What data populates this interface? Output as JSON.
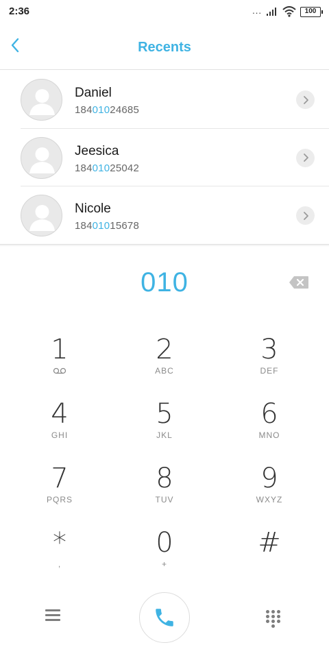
{
  "status_bar": {
    "time": "2:36",
    "signal_dots": "...",
    "battery": "100"
  },
  "header": {
    "title": "Recents",
    "back_icon": "chevron-left-icon"
  },
  "contacts": [
    {
      "name": "Daniel",
      "number_pre": "184",
      "number_match": "010",
      "number_post": "24685"
    },
    {
      "name": "Jeesica",
      "number_pre": "184",
      "number_match": "010",
      "number_post": "25042"
    },
    {
      "name": "Nicole",
      "number_pre": "184",
      "number_match": "010",
      "number_post": "15678"
    }
  ],
  "dialer": {
    "number": "010"
  },
  "keypad": [
    {
      "digit": "1",
      "letters": ""
    },
    {
      "digit": "2",
      "letters": "ABC"
    },
    {
      "digit": "3",
      "letters": "DEF"
    },
    {
      "digit": "4",
      "letters": "GHI"
    },
    {
      "digit": "5",
      "letters": "JKL"
    },
    {
      "digit": "6",
      "letters": "MNO"
    },
    {
      "digit": "7",
      "letters": "PQRS"
    },
    {
      "digit": "8",
      "letters": "TUV"
    },
    {
      "digit": "9",
      "letters": "WXYZ"
    },
    {
      "digit": "*",
      "letters": ","
    },
    {
      "digit": "0",
      "letters": "+"
    },
    {
      "digit": "#",
      "letters": ""
    }
  ],
  "colors": {
    "accent": "#3fb3e3",
    "text": "#333333",
    "muted": "#8a8a8a"
  },
  "icons": {
    "menu": "menu-icon",
    "call": "phone-icon",
    "keypad_toggle": "dialpad-icon",
    "backspace": "backspace-icon",
    "voicemail": "voicemail-icon"
  }
}
